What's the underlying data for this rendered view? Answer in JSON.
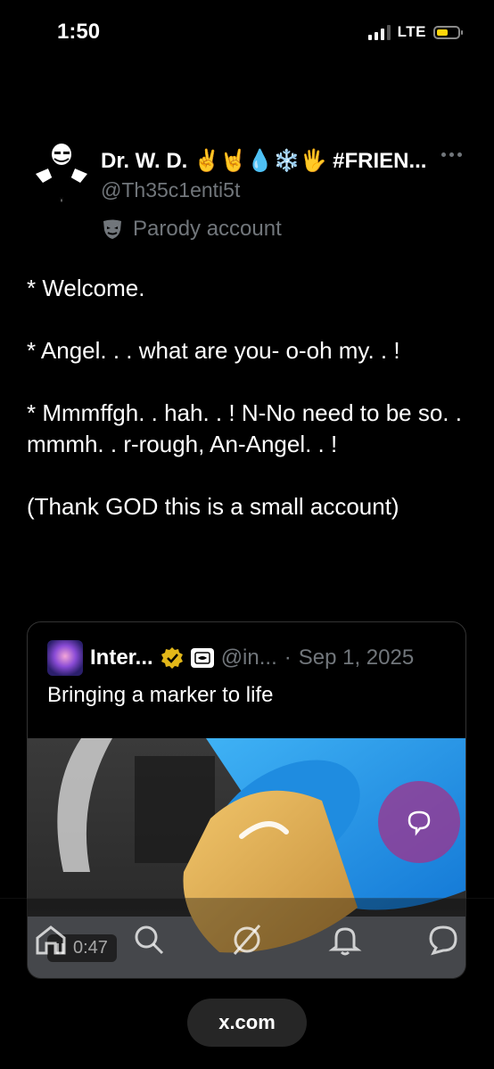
{
  "status_bar": {
    "time": "1:50",
    "network": "LTE",
    "battery_level": 0.55,
    "battery_color": "#ffd60a"
  },
  "tweet": {
    "display_name": "Dr. W. D. ✌️🤘💧❄️🖐️ #FRIEN...",
    "handle": "@Th35c1enti5t",
    "account_label": "Parody account",
    "account_label_icon": "theater-mask-icon",
    "paragraphs": [
      "* Welcome.",
      "* Angel. . . what are you- o-oh my. . !",
      "* Mmmffgh. . hah. . ! N-No need to be so. . mmmh. . r-rough, An-Angel. . !",
      "(Thank GOD this is a small account)"
    ]
  },
  "quote": {
    "name": "Inter...",
    "handle": "@in...",
    "separator": "·",
    "date": "Sep 1, 2025",
    "text": "Bringing a marker to life",
    "video_duration": "0:47"
  },
  "nav": {
    "items": [
      "home-icon",
      "search-icon",
      "grok-icon",
      "notifications-icon",
      "messages-icon"
    ]
  },
  "browser": {
    "url": "x.com"
  },
  "colors": {
    "background": "#000000",
    "muted_text": "#71767b",
    "verified_gold": "#e2b719",
    "reply_fab": "#a0328c"
  }
}
